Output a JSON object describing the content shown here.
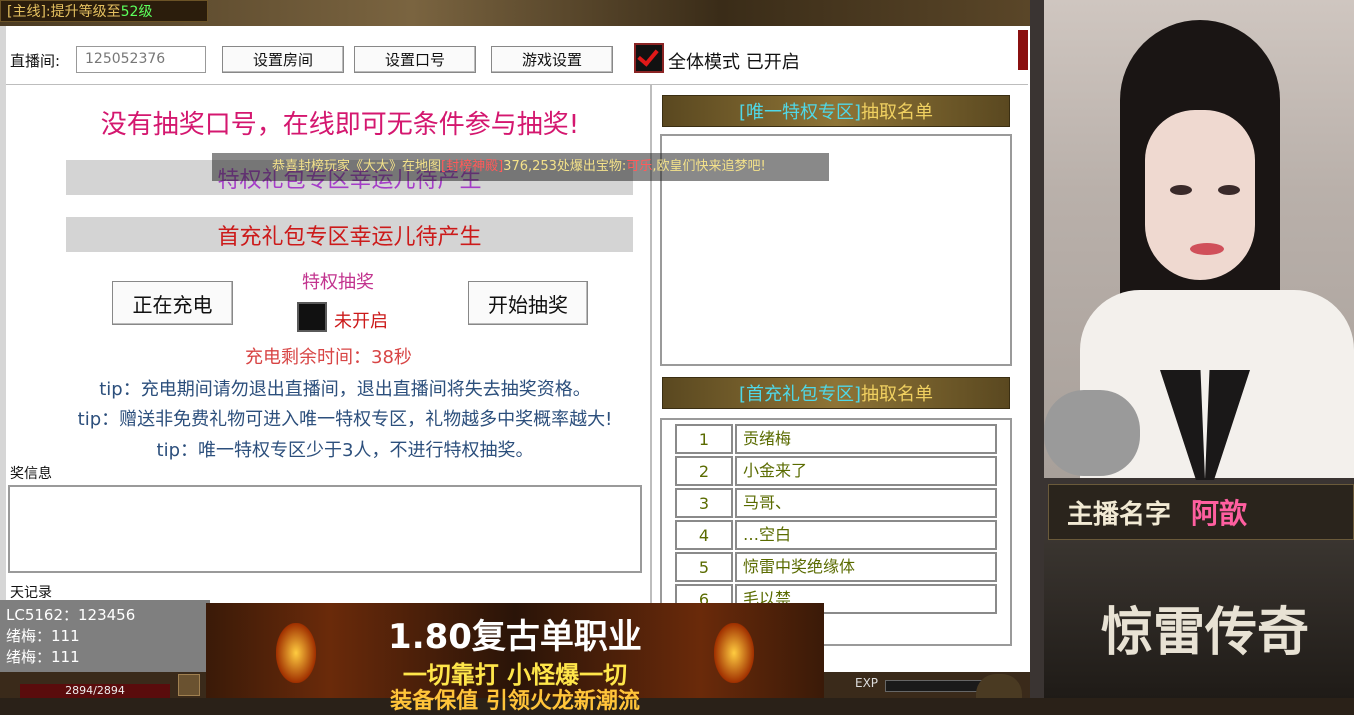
{
  "game": {
    "quest_prefix": "[主线]:提升等级至",
    "quest_level": "52级",
    "hp": "2894/2894",
    "exp_label": "EXP"
  },
  "toolbar": {
    "room_label": "直播间:",
    "room_value": "125052376",
    "set_room": "设置房间",
    "set_password": "设置口号",
    "game_settings": "游戏设置",
    "all_mode": "全体模式 已开启"
  },
  "main": {
    "headline": "没有抽奖口号，在线即可无条件参与抽奖!",
    "banner1": "特权礼包专区幸运儿待产生",
    "banner2": "首充礼包专区幸运儿待产生",
    "charging_button": "正在充电",
    "privilege_title": "特权抽奖",
    "privilege_status": "未开启",
    "start_button": "开始抽奖",
    "countdown": "充电剩余时间：38秒",
    "tips": [
      "tip：充电期间请勿退出直播间，退出直播间将失去抽奖资格。",
      "tip：赠送非免费礼物可进入唯一特权专区，礼物越多中奖概率越大!",
      "tip：唯一特权专区少于3人，不进行特权抽奖。"
    ],
    "prize_info_label": "奖信息",
    "chat_label": "天记录"
  },
  "ticker": {
    "text_a": "恭喜封榜玩家《大大》在地图",
    "text_map": "[封榜神殿]",
    "text_b": "376,253处爆出宝物:",
    "text_item": "可乐",
    "text_c": ",欧皇们快来追梦吧!"
  },
  "right": {
    "vip_header_bracket": "[唯一特权专区]",
    "vip_header_rest": " 抽取名单",
    "first_header_bracket": "[首充礼包专区]",
    "first_header_rest": " 抽取名单",
    "winners": [
      {
        "num": "1",
        "name": "贡绪梅"
      },
      {
        "num": "2",
        "name": "小金来了"
      },
      {
        "num": "3",
        "name": "马哥、"
      },
      {
        "num": "4",
        "name": "…空白"
      },
      {
        "num": "5",
        "name": "惊雷中奖绝缘体"
      },
      {
        "num": "6",
        "name": "毛以禁"
      }
    ]
  },
  "chat": [
    "LC5162：123456",
    "绪梅：111",
    "绪梅：111"
  ],
  "ad": {
    "title": "1.80复古单职业",
    "line1": "一切靠打 小怪爆一切",
    "line2": "装备保值 引领火龙新潮流"
  },
  "streamer": {
    "name_label": "主播名字",
    "name_value": "阿歆",
    "game_logo": "惊雷传奇"
  },
  "colors": {
    "headline": "#d4176f",
    "banner1_text": "#a53cc8",
    "banner2_text": "#cc1a1a",
    "countdown": "#d84545",
    "tips": "#2c4f7c",
    "header_bracket": "#4fd8e8",
    "header_text": "#f0d060"
  }
}
